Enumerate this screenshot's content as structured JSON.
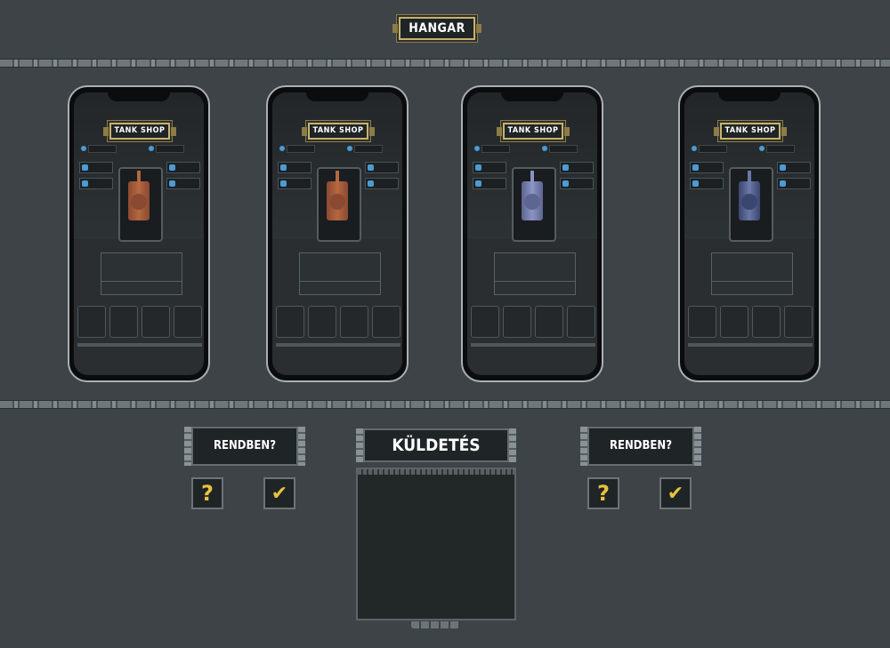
{
  "header": {
    "title": "HANGAR"
  },
  "phones": [
    {
      "shop_title": "TANK SHOP",
      "tank_color": "#8a4a32",
      "tank_shade": "#b5673f"
    },
    {
      "shop_title": "TANK SHOP",
      "tank_color": "#8a4a32",
      "tank_shade": "#b5673f"
    },
    {
      "shop_title": "TANK SHOP",
      "tank_color": "#5d6591",
      "tank_shade": "#8a94c4"
    },
    {
      "shop_title": "TANK SHOP",
      "tank_color": "#3b466e",
      "tank_shade": "#6977a8"
    }
  ],
  "left_panel": {
    "label": "RENDBEN?",
    "help_symbol": "?",
    "confirm_symbol": "✔"
  },
  "right_panel": {
    "label": "RENDBEN?",
    "help_symbol": "?",
    "confirm_symbol": "✔"
  },
  "mission": {
    "title": "KÜLDETÉS"
  },
  "colors": {
    "background": "#3d4347",
    "accent_gold": "#e6c341",
    "resource_blue": "#4b9bd4"
  }
}
